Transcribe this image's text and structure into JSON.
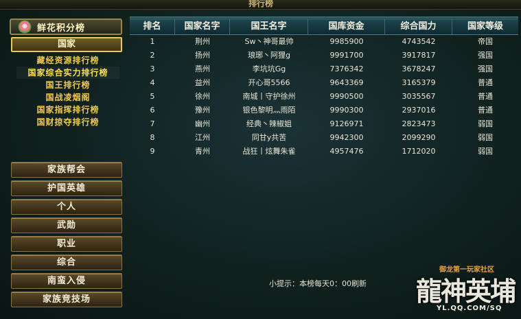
{
  "window": {
    "title": "排行榜"
  },
  "sidebar": {
    "header_label": "鲜花积分榜",
    "header_icon": "flower-icon",
    "country_tab": "国家",
    "sub_items": [
      {
        "label": "藏经资源排行榜",
        "active": false
      },
      {
        "label": "国家综合实力排行榜",
        "active": true
      },
      {
        "label": "国王排行榜",
        "active": false
      },
      {
        "label": "国战凌烟阁",
        "active": false
      },
      {
        "label": "国家指挥排行榜",
        "active": false
      },
      {
        "label": "国财掠夺排行榜",
        "active": false
      }
    ],
    "categories": [
      "家族帮会",
      "护国英雄",
      "个人",
      "武勋",
      "职业",
      "综合",
      "南蛮入侵",
      "家族竞技场"
    ]
  },
  "table": {
    "headers": [
      "排名",
      "国家名字",
      "国王名字",
      "国库资金",
      "综合国力",
      "国家等级"
    ],
    "rows": [
      [
        "1",
        "荆州",
        "Sw丶神哥最帅",
        "9985900",
        "4743542",
        "帝国"
      ],
      [
        "2",
        "扬州",
        "琅琊丶阿狸g",
        "9991700",
        "3917817",
        "强国"
      ],
      [
        "3",
        "燕州",
        "李坑坑Gg",
        "7376342",
        "3678247",
        "强国"
      ],
      [
        "4",
        "益州",
        "开心哥5566",
        "9643369",
        "3165379",
        "普通"
      ],
      [
        "5",
        "徐州",
        "南城丨守护徐州",
        "9990500",
        "3035567",
        "普通"
      ],
      [
        "6",
        "豫州",
        "银色黎明灬雨陌",
        "9990300",
        "2937016",
        "普通"
      ],
      [
        "7",
        "幽州",
        "经典丶辣椒姐",
        "9126971",
        "2823473",
        "弱国"
      ],
      [
        "8",
        "江州",
        "同甘y共苦",
        "9942300",
        "2099290",
        "弱国"
      ],
      [
        "9",
        "青州",
        "战狂丨炫舞朱雀",
        "4957476",
        "1712020",
        "弱国"
      ]
    ]
  },
  "tip": "小提示：本榜每天0：00刷新",
  "logo": {
    "subtitle": "御龙第一玩家社区",
    "main": "龍神英埔",
    "url": "YL.QQ.COM/SQ"
  }
}
